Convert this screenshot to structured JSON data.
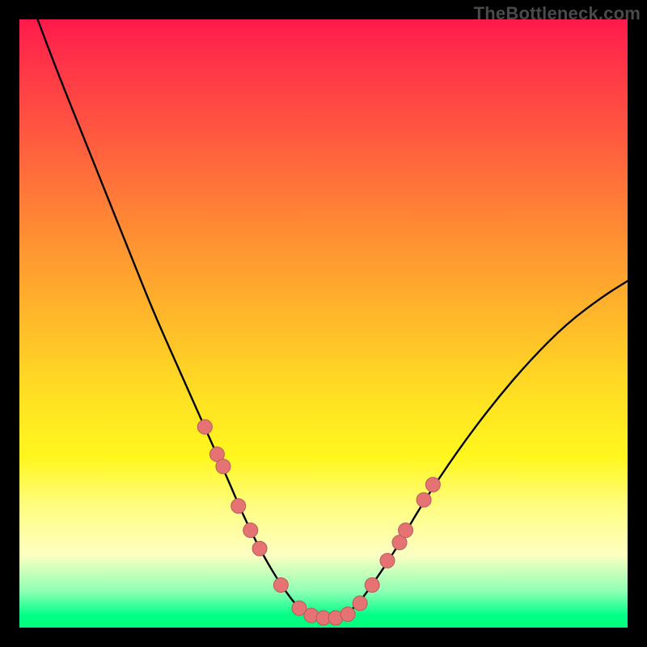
{
  "watermark": "TheBottleneck.com",
  "colors": {
    "curve": "#000000",
    "marker_fill": "#e57373",
    "marker_stroke": "#b85a5a"
  },
  "chart_data": {
    "type": "line",
    "title": "",
    "xlabel": "",
    "ylabel": "",
    "xlim": [
      0,
      100
    ],
    "ylim": [
      0,
      100
    ],
    "curve": {
      "name": "bottleneck-curve",
      "x": [
        3,
        6,
        10,
        14,
        18,
        22,
        26,
        30,
        34,
        37,
        40,
        43,
        46,
        49,
        52,
        55,
        58,
        62,
        66,
        72,
        78,
        84,
        90,
        96,
        100
      ],
      "y": [
        100,
        92,
        82,
        72,
        62,
        52,
        43,
        34,
        25,
        18,
        12,
        7,
        3,
        1.5,
        1.5,
        3,
        7,
        13,
        20,
        29,
        37,
        44,
        50,
        54.5,
        57
      ]
    },
    "markers": {
      "name": "highlight-points",
      "x": [
        30.5,
        32.5,
        33.5,
        36,
        38,
        39.5,
        43,
        46,
        48,
        50,
        52,
        54,
        56,
        58,
        60.5,
        62.5,
        63.5,
        66.5,
        68
      ],
      "y": [
        33,
        28.5,
        26.5,
        20,
        16,
        13,
        7,
        3.2,
        2,
        1.6,
        1.6,
        2.2,
        4,
        7,
        11,
        14,
        16,
        21,
        23.5
      ]
    }
  }
}
